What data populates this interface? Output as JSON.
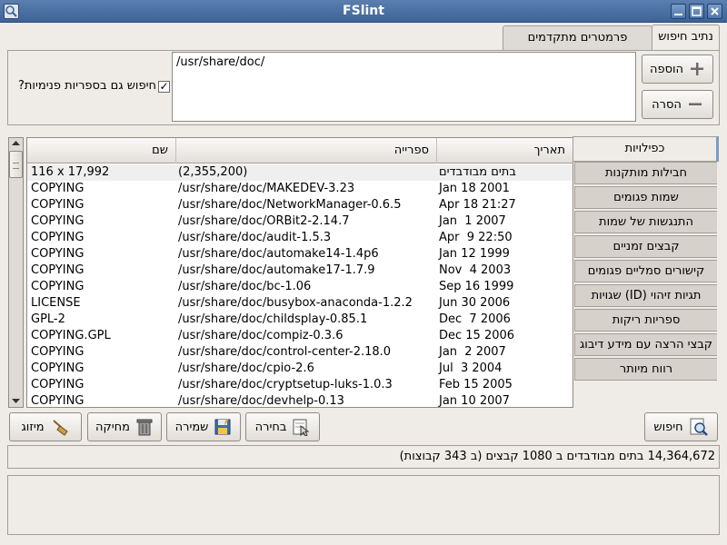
{
  "window": {
    "title": "FSlint",
    "app_icon": "magnifier-icon",
    "controls": [
      "minimize-icon",
      "maximize-icon",
      "close-icon"
    ]
  },
  "tabs": [
    {
      "label": "נתיב חיפוש",
      "active": true
    },
    {
      "label": "פרמטרים מתקדמים לחיפוש",
      "active": false
    }
  ],
  "search_path": {
    "add_label": "הוספה",
    "remove_label": "הסרה",
    "paths": [
      "/usr/share/doc/"
    ],
    "recurse_label": "חיפוש גם בספריות פנימיות?",
    "recurse_checked": true
  },
  "side_tabs": [
    {
      "label": "כפילויות",
      "active": true
    },
    {
      "label": "חבילות מותקנות",
      "active": false
    },
    {
      "label": "שמות פגומים",
      "active": false
    },
    {
      "label": "התנגשות של שמות",
      "active": false
    },
    {
      "label": "קבצים זמניים",
      "active": false
    },
    {
      "label": "קישורים סמליים פגומים",
      "active": false
    },
    {
      "label": "תגיות זיהוי (ID) שגויות",
      "active": false
    },
    {
      "label": "ספריות ריקות",
      "active": false
    },
    {
      "label": "קבצי הרצה עם מידע דיבוג",
      "active": false
    },
    {
      "label": "רווח מיותר",
      "active": false
    }
  ],
  "list": {
    "columns": [
      "שם",
      "ספרייה",
      "תאריך"
    ],
    "rows": [
      {
        "name": "116 x 17,992",
        "dir": "(2,355,200)",
        "date": "בתים מבודבדים",
        "selected": true
      },
      {
        "name": "COPYING",
        "dir": "/usr/share/doc/MAKEDEV-3.23",
        "date": "Jan 18 2001"
      },
      {
        "name": "COPYING",
        "dir": "/usr/share/doc/NetworkManager-0.6.5",
        "date": "Apr 18 21:27"
      },
      {
        "name": "COPYING",
        "dir": "/usr/share/doc/ORBit2-2.14.7",
        "date": "Jan  1 2007"
      },
      {
        "name": "COPYING",
        "dir": "/usr/share/doc/audit-1.5.3",
        "date": "Apr  9 22:50"
      },
      {
        "name": "COPYING",
        "dir": "/usr/share/doc/automake14-1.4p6",
        "date": "Jan 12 1999"
      },
      {
        "name": "COPYING",
        "dir": "/usr/share/doc/automake17-1.7.9",
        "date": "Nov  4 2003"
      },
      {
        "name": "COPYING",
        "dir": "/usr/share/doc/bc-1.06",
        "date": "Sep 16 1999"
      },
      {
        "name": "LICENSE",
        "dir": "/usr/share/doc/busybox-anaconda-1.2.2",
        "date": "Jun 30 2006"
      },
      {
        "name": "GPL-2",
        "dir": "/usr/share/doc/childsplay-0.85.1",
        "date": "Dec  7 2006"
      },
      {
        "name": "COPYING.GPL",
        "dir": "/usr/share/doc/compiz-0.3.6",
        "date": "Dec 15 2006"
      },
      {
        "name": "COPYING",
        "dir": "/usr/share/doc/control-center-2.18.0",
        "date": "Jan  2 2007"
      },
      {
        "name": "COPYING",
        "dir": "/usr/share/doc/cpio-2.6",
        "date": "Jul  3 2004"
      },
      {
        "name": "COPYING",
        "dir": "/usr/share/doc/cryptsetup-luks-1.0.3",
        "date": "Feb 15 2005"
      },
      {
        "name": "COPYING",
        "dir": "/usr/share/doc/devhelp-0.13",
        "date": "Jan 10 2007"
      }
    ]
  },
  "actions": {
    "sort_label": "מיזוג",
    "delete_label": "מחיקה",
    "save_label": "שמירה",
    "select_label": "בחירה",
    "find_label": "חיפוש"
  },
  "status": {
    "text": "14,364,672 בתים מבודבדים ב 1080 קבצים (ב 343 קבוצות)"
  }
}
